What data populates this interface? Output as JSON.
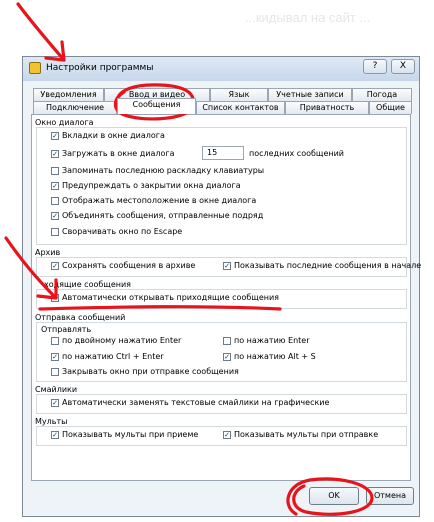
{
  "background_text": "...кидывал на сайт ...",
  "window": {
    "title": "Настройки программы",
    "help_button": "?",
    "close_button": "X"
  },
  "tabs": [
    {
      "label": "Уведомления"
    },
    {
      "label": "Ввод и видео"
    },
    {
      "label": "Язык"
    },
    {
      "label": "Учетные записи"
    },
    {
      "label": "Погода"
    },
    {
      "label": "Подключение"
    },
    {
      "label": "Сообщения"
    },
    {
      "label": "Список контактов"
    },
    {
      "label": "Приватность"
    },
    {
      "label": "Общие"
    }
  ],
  "active_tab": "Сообщения",
  "groups": {
    "dialog": {
      "title": "Окно диалога",
      "options": [
        {
          "label": "Вкладки в окне диалога",
          "checked": true
        },
        {
          "label": "Загружать в окне диалога",
          "checked": true
        },
        {
          "label": "Запоминать последнюю раскладку клавиатуры",
          "checked": false
        },
        {
          "label": "Предупреждать о закрытии окна диалога",
          "checked": true
        },
        {
          "label": "Отображать местоположение в окне диалога",
          "checked": false
        },
        {
          "label": "Объединять сообщения, отправленные подряд",
          "checked": true
        },
        {
          "label": "Сворачивать окно по Escape",
          "checked": false
        }
      ],
      "load_count": "15",
      "load_suffix": "последних сообщений"
    },
    "archive": {
      "title": "Архив",
      "options": [
        {
          "label": "Сохранять сообщения в архиве",
          "checked": true
        },
        {
          "label": "Показывать последние сообщения в начале",
          "checked": true
        }
      ]
    },
    "incoming": {
      "title": "ходящие сообщения",
      "options": [
        {
          "label": "Автоматически открывать приходящие сообщения",
          "checked": true
        }
      ]
    },
    "sending": {
      "title": "Отправка сообщений",
      "subtitle": "Отправлять",
      "options": [
        {
          "label": "по двойному нажатию Enter",
          "checked": false
        },
        {
          "label": "по нажатию Enter",
          "checked": false
        },
        {
          "label": "по нажатию Ctrl + Enter",
          "checked": true
        },
        {
          "label": "по нажатию Alt + S",
          "checked": true
        },
        {
          "label": "Закрывать окно при отправке сообщения",
          "checked": false
        }
      ]
    },
    "smileys": {
      "title": "Смайлики",
      "options": [
        {
          "label": "Автоматически заменять текстовые смайлики на графические",
          "checked": true
        }
      ]
    },
    "multy": {
      "title": "Мульты",
      "options": [
        {
          "label": "Показывать мульты при приеме",
          "checked": true
        },
        {
          "label": "Показывать мульты при отправке",
          "checked": true
        }
      ]
    }
  },
  "buttons": {
    "ok": "OK",
    "cancel": "Отмена"
  },
  "annotation_color": "#e8141b"
}
